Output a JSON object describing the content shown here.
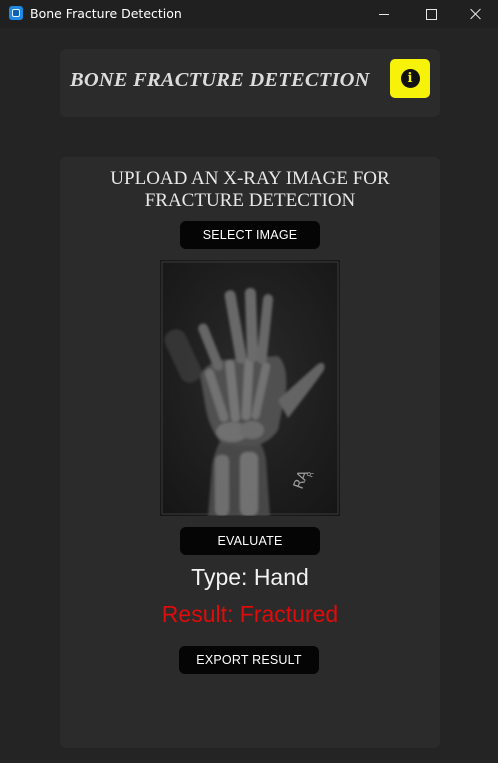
{
  "window": {
    "title": "Bone Fracture Detection",
    "icon": "app-window-icon",
    "controls": [
      "minimize-icon",
      "maximize-icon",
      "close-icon"
    ]
  },
  "header": {
    "title": "BONE FRACTURE DETECTION",
    "info_icon": "info-icon",
    "info_glyph": "i",
    "info_color": "#f7f20a"
  },
  "upload": {
    "heading_line1": "UPLOAD AN X-RAY IMAGE FOR",
    "heading_line2": "FRACTURE DETECTION",
    "select_label": "SELECT IMAGE",
    "image_marker": "RA",
    "image_marker_sub": "R"
  },
  "evaluation": {
    "evaluate_label": "EVALUATE",
    "type_text": "Type: Hand",
    "result_text": "Result: Fractured",
    "result_color": "#e00b0b",
    "export_label": "EXPORT RESULT"
  }
}
